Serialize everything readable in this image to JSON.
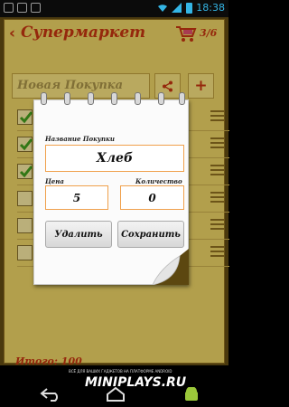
{
  "status_bar": {
    "time": "18:38"
  },
  "header": {
    "back_icon": "chevron-left-icon",
    "title": "Супермаркет",
    "counter": "3/6",
    "cart_icon": "shopping-cart-icon"
  },
  "search": {
    "placeholder": "Новая Покупка",
    "share_icon": "share-icon",
    "add_label": "+"
  },
  "list": {
    "rows": [
      {
        "checked": true
      },
      {
        "checked": true
      },
      {
        "checked": true
      },
      {
        "checked": false
      },
      {
        "checked": false
      },
      {
        "checked": false
      }
    ]
  },
  "footer": {
    "total": "Итого: 100"
  },
  "dialog": {
    "name_label": "Название Покупки",
    "name_value": "Хлеб",
    "price_label": "Цена",
    "price_value": "5",
    "qty_label": "Количество",
    "qty_value": "0",
    "delete_label": "Удалить",
    "save_label": "Сохранить"
  },
  "banner": {
    "small_text": "ВСЁ ДЛЯ ВАШИХ ГАДЖЕТОВ НА ПЛАТФОРМЕ ANDROID",
    "brand": "MINIPLAYS.RU"
  },
  "colors": {
    "accent": "#c1300e",
    "paper": "#e7cf63",
    "field_border": "#f0a04b"
  }
}
